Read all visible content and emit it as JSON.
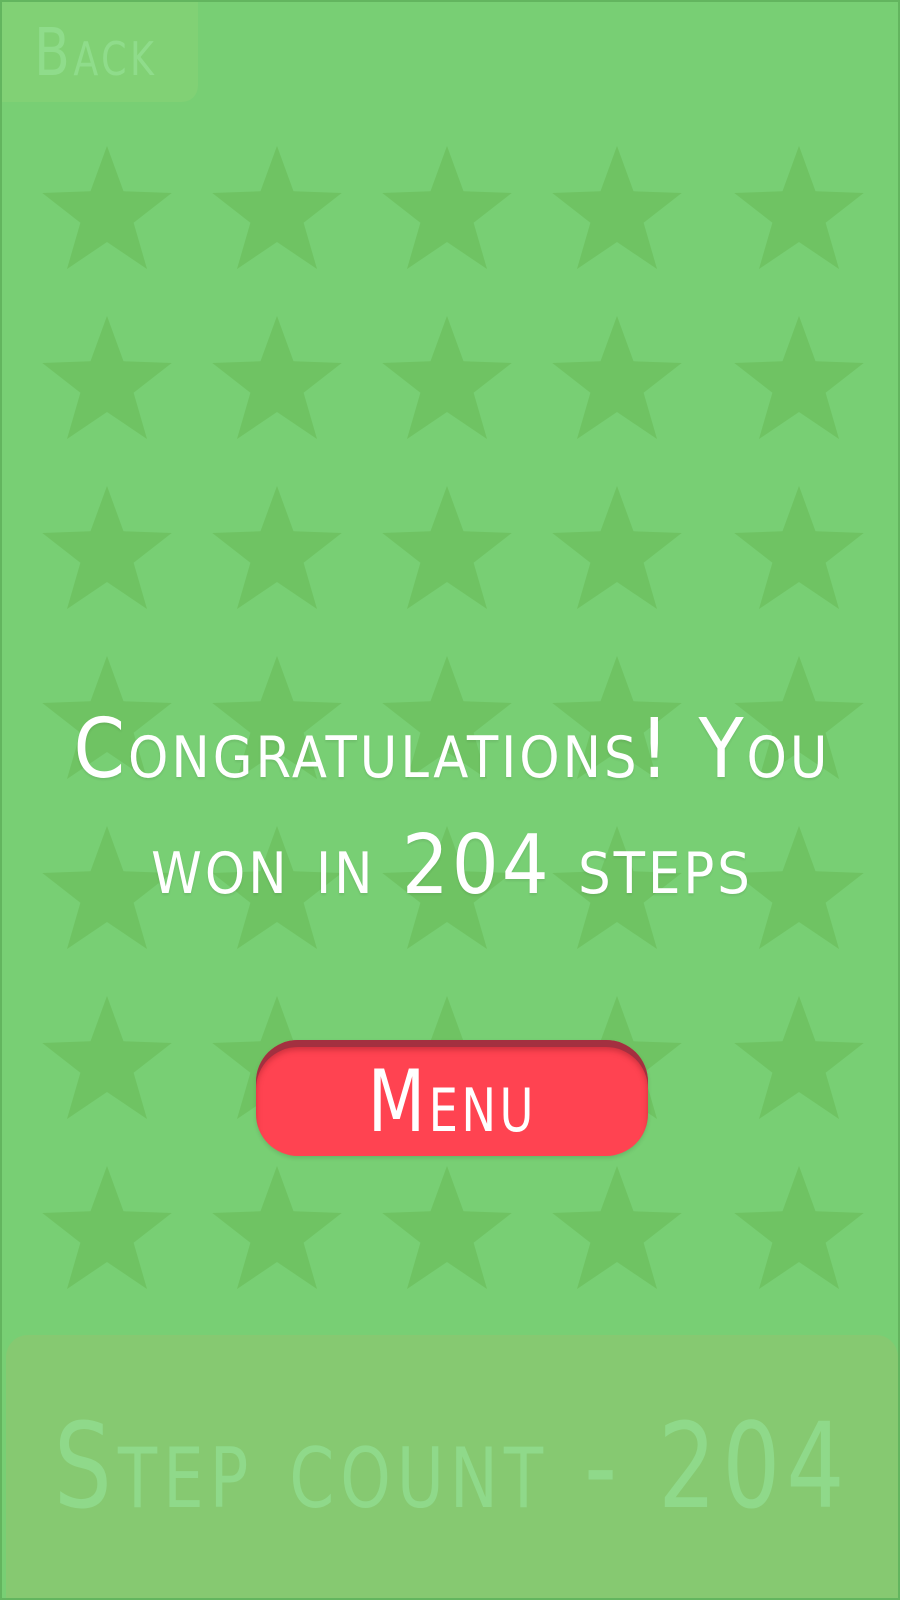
{
  "screen": {
    "background_color": "#78cf74",
    "star_color": "#6fc363",
    "star_icon": "star-icon"
  },
  "back_button": {
    "label": "Back"
  },
  "result": {
    "message_line1": "Congratulations! You",
    "message_line2": "won in 204 steps",
    "steps": 204
  },
  "menu_button": {
    "label": "Menu",
    "color": "#ff4351"
  },
  "step_counter": {
    "label": "Step count - 204"
  }
}
